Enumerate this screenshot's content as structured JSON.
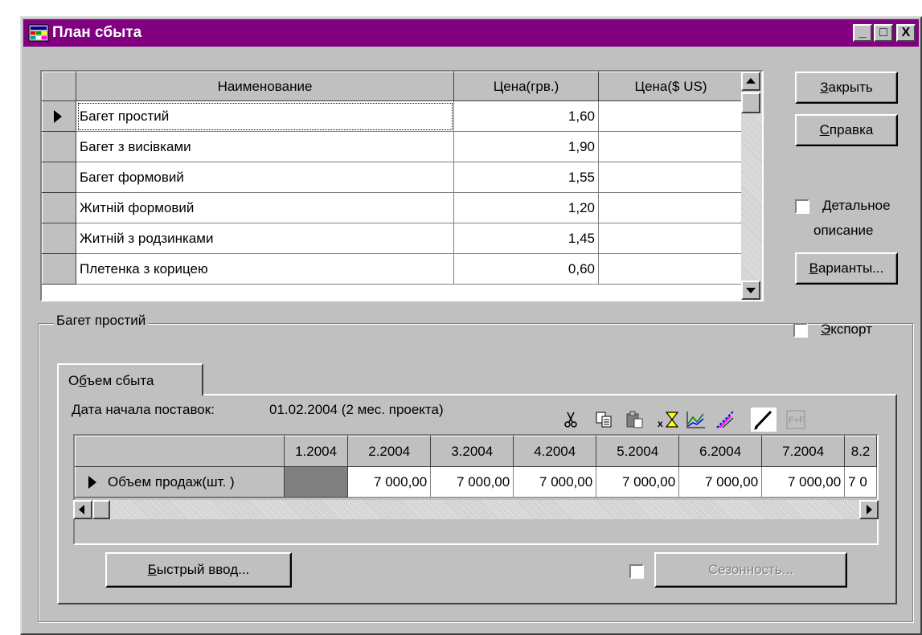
{
  "window": {
    "title": "План сбыта",
    "controls": {
      "minimize": "_",
      "maximize": "□",
      "close": "X"
    }
  },
  "products": {
    "columns": [
      "Наименование",
      "Цена(грв.)",
      "Цена($ US)"
    ],
    "rows": [
      {
        "name": "Багет простий",
        "price_uah": "1,60",
        "price_usd": ""
      },
      {
        "name": "Багет з висівками",
        "price_uah": "1,90",
        "price_usd": ""
      },
      {
        "name": "Багет формовий",
        "price_uah": "1,55",
        "price_usd": ""
      },
      {
        "name": "Житній формовий",
        "price_uah": "1,20",
        "price_usd": ""
      },
      {
        "name": "Житній з родзинками",
        "price_uah": "1,45",
        "price_usd": ""
      },
      {
        "name": "Плетенка з корицею",
        "price_uah": "0,60",
        "price_usd": ""
      }
    ],
    "selected_row": 0
  },
  "buttons": {
    "close": {
      "hot": "З",
      "rest": "акрыть"
    },
    "help": {
      "hot": "С",
      "rest": "правка"
    },
    "variants": {
      "hot": "В",
      "rest": "арианты..."
    },
    "quick_input": {
      "hot": "Б",
      "rest": "ыстрый ввод..."
    },
    "seasonality": "Сезонность..."
  },
  "detail_checkbox": {
    "line1_hot": "Д",
    "line1_rest": "етальное",
    "line2": "описание",
    "checked": false
  },
  "group": {
    "title": "Багет простий",
    "export_checkbox": {
      "hot": "Э",
      "rest": "кспорт",
      "checked": false
    },
    "tab": {
      "pre": "О",
      "hot": "б",
      "rest": "ъем сбыта"
    },
    "start_date_label": "Дата начала поставок:",
    "start_date_value": "01.02.2004 (2 мес. проекта)",
    "toolbar_icons": [
      "cut-icon",
      "copy-icon",
      "paste-icon",
      "hourglass-icon",
      "line-chart-icon",
      "trend-icon",
      "pencil-icon",
      "formula-icon"
    ],
    "volume_table": {
      "periods": [
        "1.2004",
        "2.2004",
        "3.2004",
        "4.2004",
        "5.2004",
        "6.2004",
        "7.2004",
        "8.2"
      ],
      "row_label": "Объем продаж(шт. )",
      "values": [
        "",
        "7 000,00",
        "7 000,00",
        "7 000,00",
        "7 000,00",
        "7 000,00",
        "7 000,00",
        "7 0"
      ]
    },
    "seasonality_checked": false
  }
}
